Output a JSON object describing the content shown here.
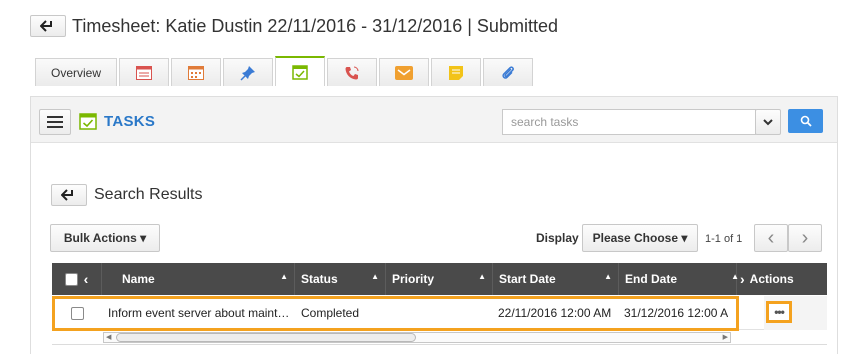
{
  "header": {
    "back_icon": "arrow-left-icon",
    "title": "Timesheet: Katie Dustin 22/11/2016 - 31/12/2016 | Submitted"
  },
  "tabs": [
    {
      "label": "Overview",
      "icon": null
    },
    {
      "label": "",
      "icon": "report-icon",
      "color": "#d9534f"
    },
    {
      "label": "",
      "icon": "calendar-icon",
      "color": "#e07b39"
    },
    {
      "label": "",
      "icon": "pin-icon",
      "color": "#3a7bd5"
    },
    {
      "label": "",
      "icon": "tasks-icon",
      "color": "#7ab800",
      "active": true
    },
    {
      "label": "",
      "icon": "phone-icon",
      "color": "#d9534f"
    },
    {
      "label": "",
      "icon": "email-icon",
      "color": "#f0a030"
    },
    {
      "label": "",
      "icon": "note-icon",
      "color": "#f2c318"
    },
    {
      "label": "",
      "icon": "attachment-icon",
      "color": "#3a7bd5"
    }
  ],
  "panel": {
    "title": "TASKS",
    "search_placeholder": "search tasks",
    "menu_icon": "hamburger-icon",
    "search_icon": "magnifier-icon"
  },
  "results": {
    "title": "Search Results",
    "bulk_actions": "Bulk Actions ▾",
    "display_label": "Display",
    "display_value": "Please Choose ▾",
    "page_range": "1-1 of 1",
    "prev": "‹",
    "next": "›"
  },
  "table": {
    "columns": [
      "Name",
      "Status",
      "Priority",
      "Start Date",
      "End Date",
      "Actions"
    ],
    "rows": [
      {
        "name": "Inform event server about maint…",
        "status": "Completed",
        "priority": "",
        "start_date": "22/11/2016 12:00 AM",
        "end_date": "31/12/2016 12:00 A",
        "actions": "•••"
      }
    ]
  },
  "colors": {
    "accent_blue": "#2a78c8",
    "header_dark": "#4a4a4a",
    "highlight": "#f4a21f",
    "search_button": "#3c8fe3"
  }
}
